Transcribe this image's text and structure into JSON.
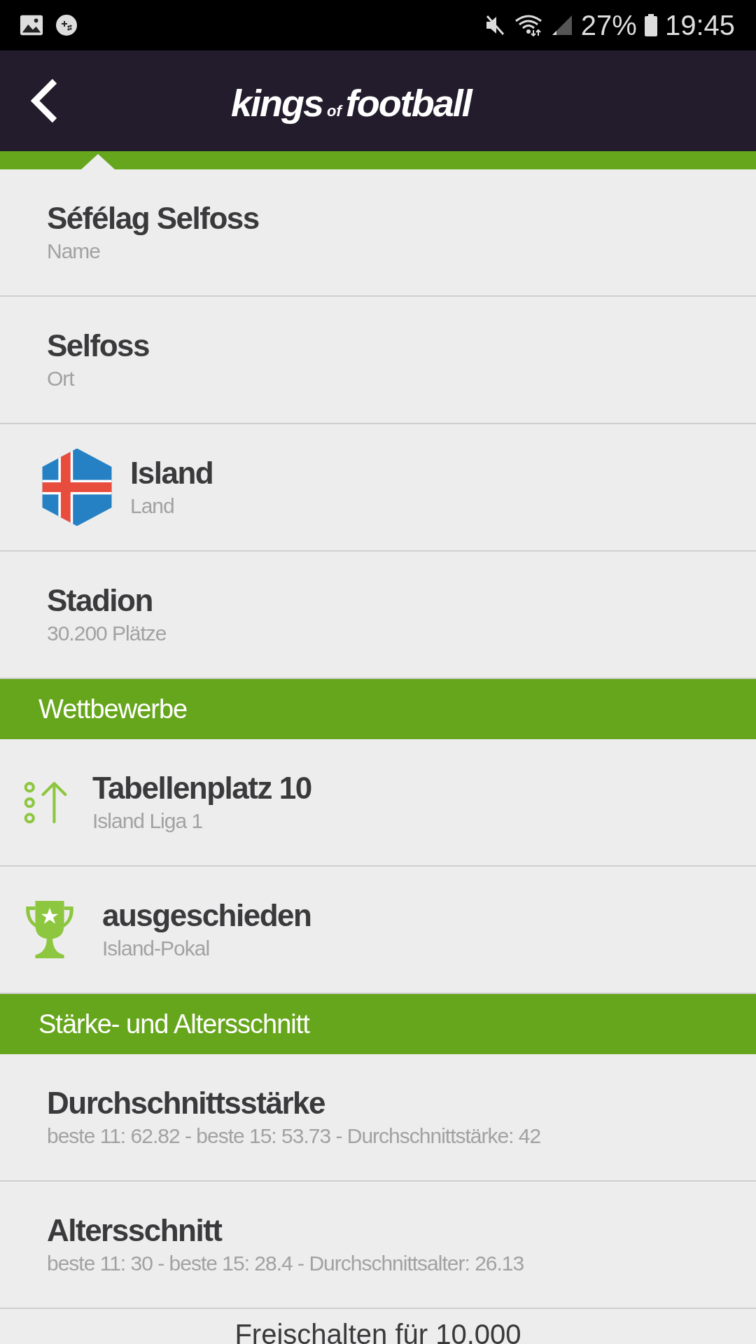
{
  "status_bar": {
    "battery": "27%",
    "time": "19:45"
  },
  "header": {
    "logo": {
      "first": "kings",
      "middle": "of",
      "last": "football"
    }
  },
  "info_rows": [
    {
      "kind": "plain",
      "title": "Séfélag Selfoss",
      "subtitle": "Name"
    },
    {
      "kind": "plain",
      "title": "Selfoss",
      "subtitle": "Ort"
    },
    {
      "kind": "flag",
      "title": "Island",
      "subtitle": "Land"
    },
    {
      "kind": "plain",
      "title": "Stadion",
      "subtitle": "30.200 Plätze"
    }
  ],
  "sections": [
    {
      "title": "Wettbewerbe",
      "rows": [
        {
          "kind": "rank",
          "title": "Tabellenplatz 10",
          "subtitle": "Island Liga 1"
        },
        {
          "kind": "trophy",
          "title": "ausgeschieden",
          "subtitle": "Island-Pokal"
        }
      ]
    },
    {
      "title": "Stärke- und Altersschnitt",
      "rows": [
        {
          "kind": "plain",
          "title": "Durchschnittsstärke",
          "subtitle": "beste 11: 62.82 - beste 15: 53.73 - Durchschnittstärke: 42"
        },
        {
          "kind": "plain",
          "title": "Altersschnitt",
          "subtitle": "beste 11: 30 - beste 15: 28.4 - Durchschnittsalter: 26.13"
        }
      ]
    }
  ],
  "footer_button": "Freischalten für 10.000"
}
